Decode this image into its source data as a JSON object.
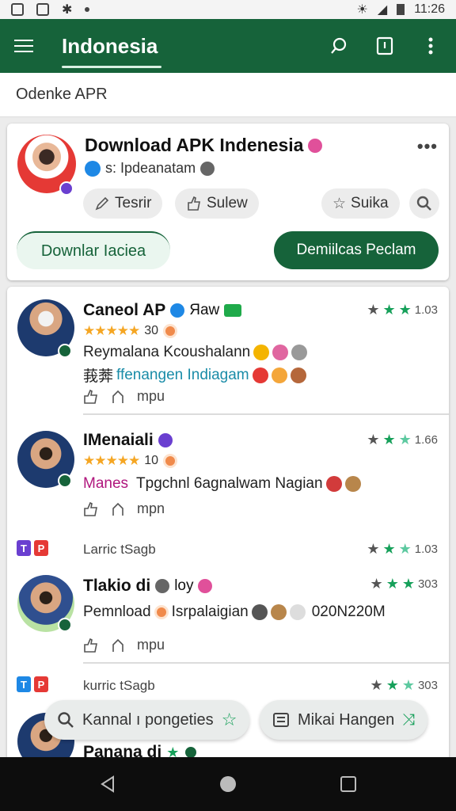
{
  "status_bar": {
    "time": "11:26"
  },
  "app_bar": {
    "title": "Indonesia"
  },
  "search": {
    "value": "Odenke APR"
  },
  "featured": {
    "title": "Download APK Indenesia",
    "subtitle": "s: Ipdeanatam",
    "chips": [
      "Tesrir",
      "Sulew",
      "Suika"
    ],
    "button_outline": "Downlar Iaciea",
    "button_solid": "Demiilcas Peclam"
  },
  "items": [
    {
      "name": "Caneol AP",
      "name_suffix": "Яaw",
      "rating": "1.03",
      "stars_count": "30",
      "line1": "Reymalana Kcoushalann",
      "line2_prefix": "莪莾",
      "line2_teal": "ffenangen Indiagam",
      "action": "mpu"
    },
    {
      "name": "IMenaiali",
      "rating": "1.66",
      "stars_count": "10",
      "line1_magenta": "Manes",
      "line1": "Tpgchnl 6agnalwam Nagian",
      "action": "mpn"
    },
    {
      "app_meta": "Larric tSagb",
      "rating": "1.03",
      "tag1": "T",
      "tag2": "P"
    },
    {
      "name": "Tlakio di",
      "name_suffix": "loy",
      "rating": "303",
      "line1": "Pemnload",
      "line1_b": "Isrpalaigian",
      "line1_c": "020N220M",
      "action": "mpu"
    },
    {
      "app_meta": "kurric tSagb",
      "rating": "303",
      "tag1": "T",
      "tag2": "P"
    },
    {
      "name": "Panana di"
    }
  ],
  "floating": {
    "left": "Kannal ı pongeties",
    "right": "Mikai Hangen"
  },
  "stars": "★★★★★",
  "colors": {
    "primary": "#16633a",
    "star_gold": "#f5a623",
    "star_green": "#16a05a"
  }
}
